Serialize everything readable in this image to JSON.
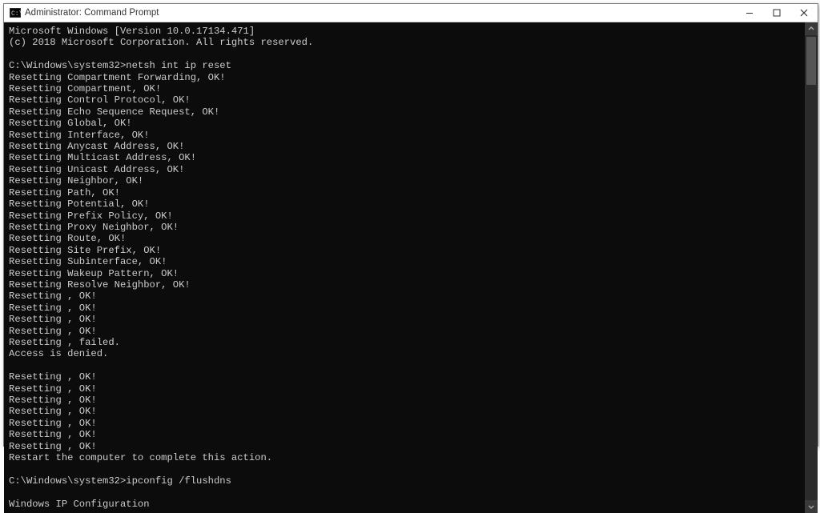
{
  "window": {
    "title": "Administrator: Command Prompt",
    "icon_label": "cmd"
  },
  "terminal": {
    "lines": [
      "Microsoft Windows [Version 10.0.17134.471]",
      "(c) 2018 Microsoft Corporation. All rights reserved.",
      "",
      "C:\\Windows\\system32>netsh int ip reset",
      "Resetting Compartment Forwarding, OK!",
      "Resetting Compartment, OK!",
      "Resetting Control Protocol, OK!",
      "Resetting Echo Sequence Request, OK!",
      "Resetting Global, OK!",
      "Resetting Interface, OK!",
      "Resetting Anycast Address, OK!",
      "Resetting Multicast Address, OK!",
      "Resetting Unicast Address, OK!",
      "Resetting Neighbor, OK!",
      "Resetting Path, OK!",
      "Resetting Potential, OK!",
      "Resetting Prefix Policy, OK!",
      "Resetting Proxy Neighbor, OK!",
      "Resetting Route, OK!",
      "Resetting Site Prefix, OK!",
      "Resetting Subinterface, OK!",
      "Resetting Wakeup Pattern, OK!",
      "Resetting Resolve Neighbor, OK!",
      "Resetting , OK!",
      "Resetting , OK!",
      "Resetting , OK!",
      "Resetting , OK!",
      "Resetting , failed.",
      "Access is denied.",
      "",
      "Resetting , OK!",
      "Resetting , OK!",
      "Resetting , OK!",
      "Resetting , OK!",
      "Resetting , OK!",
      "Resetting , OK!",
      "Resetting , OK!",
      "Restart the computer to complete this action.",
      "",
      "C:\\Windows\\system32>ipconfig /flushdns",
      "",
      "Windows IP Configuration"
    ]
  }
}
